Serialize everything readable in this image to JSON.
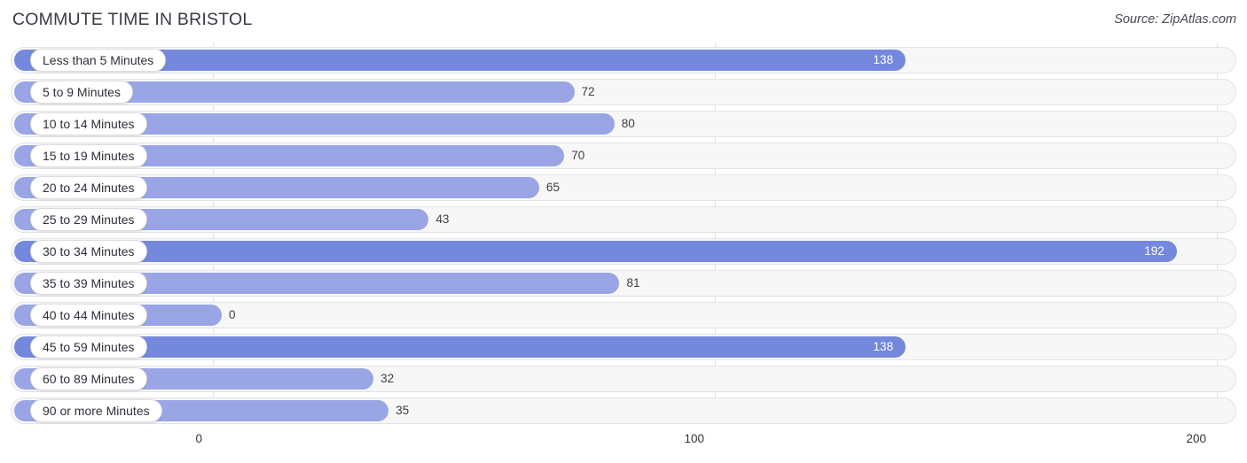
{
  "header": {
    "title": "COMMUTE TIME IN BRISTOL",
    "source": "Source: ZipAtlas.com"
  },
  "colors": {
    "bar": "#9aa5e6",
    "bar_highlight": "#7489de",
    "track": "#f7f7f7",
    "track_border": "#e3e3e6",
    "gridline": "#e2e2e6",
    "value_text_inside": "#ffffff",
    "value_text_outside": "#3c3c44",
    "title_text": "#3a3a44"
  },
  "axis": {
    "ticks": [
      {
        "label": "0",
        "value": 0
      },
      {
        "label": "100",
        "value": 100
      },
      {
        "label": "200",
        "value": 200
      }
    ]
  },
  "chart_data": {
    "type": "bar",
    "orientation": "horizontal",
    "title": "COMMUTE TIME IN BRISTOL",
    "xlabel": "",
    "ylabel": "",
    "xlim": [
      0,
      200
    ],
    "grid": true,
    "legend": null,
    "categories": [
      "Less than 5 Minutes",
      "5 to 9 Minutes",
      "10 to 14 Minutes",
      "15 to 19 Minutes",
      "20 to 24 Minutes",
      "25 to 29 Minutes",
      "30 to 34 Minutes",
      "35 to 39 Minutes",
      "40 to 44 Minutes",
      "45 to 59 Minutes",
      "60 to 89 Minutes",
      "90 or more Minutes"
    ],
    "values": [
      138,
      72,
      80,
      70,
      65,
      43,
      192,
      81,
      0,
      138,
      32,
      35
    ],
    "value_labels": [
      "138",
      "72",
      "80",
      "70",
      "65",
      "43",
      "192",
      "81",
      "0",
      "138",
      "32",
      "35"
    ]
  }
}
